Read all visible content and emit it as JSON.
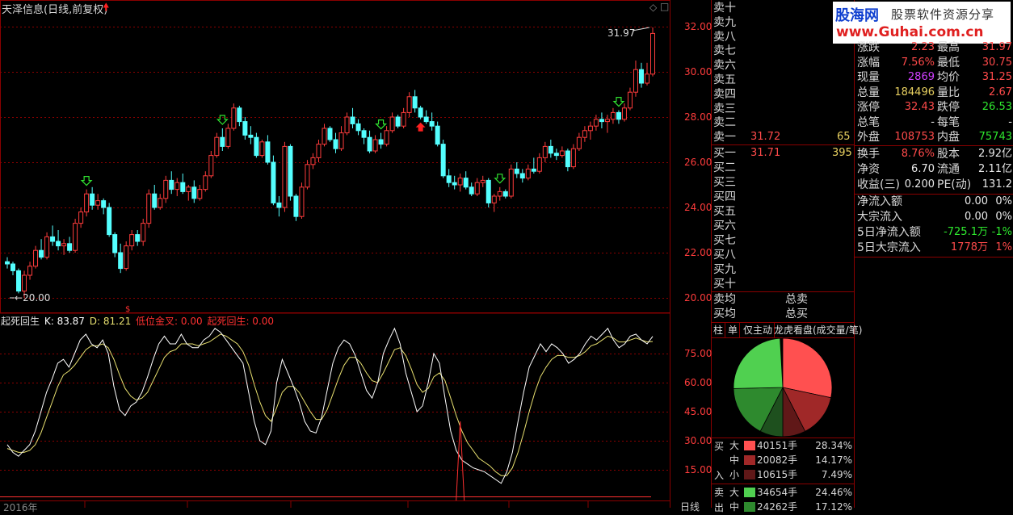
{
  "main_title": "天泽信息(日线,前复权)",
  "indicator": {
    "name": "起死回生",
    "k_text": "K: 83.87",
    "d_text": "D: 81.21",
    "g1_text": "低位金叉: 0.00",
    "g2_text": "起死回生: 0.00"
  },
  "price_axis": [
    "32.00",
    "30.00",
    "28.00",
    "26.00",
    "24.00",
    "22.00",
    "20.00"
  ],
  "ind_axis": [
    "75.00",
    "60.00",
    "45.00",
    "30.00",
    "15.00"
  ],
  "annot_high": "31.97",
  "annot_low": "20.00",
  "bottom_axis": {
    "date_label": "2016年",
    "period_label": "日线"
  },
  "logo": {
    "cn_text": "股海网",
    "slogan": "股票软件资源分享",
    "url": "www.Guhai.com.cn"
  },
  "sell_levels": [
    "卖十",
    "卖九",
    "卖八",
    "卖七",
    "卖六",
    "卖五",
    "卖四",
    "卖三",
    "卖二",
    "卖一"
  ],
  "sell1": {
    "price": "31.72",
    "vol": "65"
  },
  "buy_levels": [
    "买一",
    "买二",
    "买三",
    "买四",
    "买五",
    "买六",
    "买七",
    "买八",
    "买九",
    "买十"
  ],
  "buy1": {
    "price": "31.71",
    "vol": "395"
  },
  "avg_rows": [
    {
      "label": "卖均",
      "total": "总卖"
    },
    {
      "label": "买均",
      "total": "总买"
    }
  ],
  "stats_top": [
    {
      "l1": "涨跌",
      "v1": "2.23",
      "l2": "最高",
      "v2": "31.97"
    },
    {
      "l1": "涨幅",
      "v1": "7.56%",
      "l2": "最低",
      "v2": "30.75"
    },
    {
      "l1": "现量",
      "v1": "2869",
      "l2": "均价",
      "v2": "31.25"
    },
    {
      "l1": "总量",
      "v1": "184496",
      "l2": "量比",
      "v2": "2.67"
    },
    {
      "l1": "涨停",
      "v1": "32.43",
      "l2": "跌停",
      "v2": "26.53"
    },
    {
      "l1": "总笔",
      "v1": "-",
      "l2": "每笔",
      "v2": "-"
    },
    {
      "l1": "外盘",
      "v1": "108753",
      "l2": "内盘",
      "v2": "75743"
    }
  ],
  "stats_mid": [
    {
      "l1": "换手",
      "v1": "8.76%",
      "l2": "股本",
      "v2": "2.92亿"
    },
    {
      "l1": "净资",
      "v1": "6.70",
      "l2": "流通",
      "v2": "2.11亿"
    },
    {
      "l1": "收益(三)",
      "v1": "0.200",
      "l2": "PE(动)",
      "v2": "131.2"
    }
  ],
  "flow_rows": [
    {
      "label": "净流入额",
      "value": "0.00",
      "pct": "0%"
    },
    {
      "label": "大宗流入",
      "value": "0.00",
      "pct": "0%"
    },
    {
      "label": "5日净流入额",
      "value": "-725.1万",
      "pct": "-1%"
    },
    {
      "label": "5日大宗流入",
      "value": "1778万",
      "pct": "1%"
    }
  ],
  "tabs": [
    "柱",
    "单",
    "仅主动",
    "龙虎看盘(成交量/笔)"
  ],
  "pie": [
    {
      "share": 28.34,
      "color": "#ff5050"
    },
    {
      "share": 14.17,
      "color": "#a02828"
    },
    {
      "share": 7.49,
      "color": "#601818"
    },
    {
      "share": 7.53,
      "color": "#1e501e"
    },
    {
      "share": 17.12,
      "color": "#2e8a2e"
    },
    {
      "share": 24.46,
      "color": "#50d050"
    }
  ],
  "flow_side": {
    "buy_c1": "买",
    "buy_c2": "入",
    "sell_c1": "卖",
    "sell_c2": "出"
  },
  "flow_table": [
    {
      "side": "buy",
      "size": "大",
      "vol": "40151手",
      "pct": "28.34%",
      "color": "#ff5050"
    },
    {
      "side": "buy",
      "size": "中",
      "vol": "20082手",
      "pct": "14.17%",
      "color": "#a02828"
    },
    {
      "side": "buy",
      "size": "小",
      "vol": "10615手",
      "pct": "7.49%",
      "color": "#601818"
    },
    {
      "side": "sell",
      "size": "大",
      "vol": "34654手",
      "pct": "24.46%",
      "color": "#50d050"
    },
    {
      "side": "sell",
      "size": "中",
      "vol": "24262手",
      "pct": "17.12%",
      "color": "#2e8a2e"
    }
  ],
  "colors": {
    "up": "#ff3c3c",
    "down": "#54ffff",
    "grid": "#8a0000",
    "k_line": "#ffffff",
    "d_line": "#e8e070"
  },
  "chart_data": {
    "type": "candlestick",
    "price_range": [
      20,
      32
    ],
    "indicator_range": [
      0,
      100
    ],
    "kline": [
      [
        21.6,
        21.8,
        21.3,
        21.5
      ],
      [
        21.5,
        21.6,
        21.0,
        21.2
      ],
      [
        21.2,
        21.3,
        20.2,
        20.3
      ],
      [
        20.3,
        21.2,
        20.0,
        21.0
      ],
      [
        21.0,
        21.6,
        20.8,
        21.4
      ],
      [
        21.4,
        22.3,
        21.3,
        22.1
      ],
      [
        22.1,
        22.6,
        21.7,
        21.8
      ],
      [
        21.8,
        22.9,
        21.7,
        22.7
      ],
      [
        22.7,
        23.2,
        22.3,
        22.5
      ],
      [
        22.5,
        23.0,
        22.1,
        22.3
      ],
      [
        22.3,
        22.6,
        21.9,
        22.4
      ],
      [
        22.4,
        22.7,
        22.0,
        22.1
      ],
      [
        22.1,
        23.5,
        22.0,
        23.3
      ],
      [
        23.3,
        24.0,
        23.1,
        23.8
      ],
      [
        23.8,
        24.8,
        23.6,
        24.6
      ],
      [
        24.6,
        24.9,
        23.9,
        24.1
      ],
      [
        24.1,
        24.6,
        23.9,
        24.3
      ],
      [
        24.3,
        24.4,
        23.7,
        24.0
      ],
      [
        24.0,
        24.2,
        22.7,
        22.8
      ],
      [
        22.8,
        22.9,
        21.8,
        22.0
      ],
      [
        22.0,
        22.4,
        21.1,
        21.3
      ],
      [
        21.3,
        22.5,
        21.2,
        22.3
      ],
      [
        22.3,
        23.0,
        22.1,
        22.8
      ],
      [
        22.8,
        23.0,
        22.3,
        22.5
      ],
      [
        22.5,
        23.5,
        22.3,
        23.3
      ],
      [
        23.3,
        24.8,
        23.1,
        24.6
      ],
      [
        24.6,
        25.0,
        23.9,
        24.0
      ],
      [
        24.0,
        24.6,
        23.9,
        24.4
      ],
      [
        24.4,
        25.4,
        24.2,
        25.2
      ],
      [
        25.2,
        25.6,
        24.6,
        24.8
      ],
      [
        24.8,
        25.3,
        24.5,
        25.1
      ],
      [
        25.1,
        25.5,
        24.6,
        24.7
      ],
      [
        24.7,
        25.0,
        24.3,
        24.9
      ],
      [
        24.9,
        25.2,
        24.2,
        24.4
      ],
      [
        24.4,
        25.0,
        24.3,
        24.8
      ],
      [
        24.8,
        25.6,
        24.7,
        25.4
      ],
      [
        25.4,
        26.5,
        25.3,
        26.3
      ],
      [
        26.3,
        27.3,
        26.2,
        27.1
      ],
      [
        27.1,
        27.5,
        26.5,
        26.7
      ],
      [
        26.7,
        27.7,
        26.6,
        27.5
      ],
      [
        27.5,
        28.6,
        27.4,
        28.4
      ],
      [
        28.4,
        28.5,
        27.6,
        27.8
      ],
      [
        27.8,
        28.0,
        27.0,
        27.2
      ],
      [
        27.2,
        27.6,
        26.8,
        27.1
      ],
      [
        27.1,
        27.3,
        26.2,
        26.3
      ],
      [
        26.3,
        27.0,
        26.2,
        26.9
      ],
      [
        26.9,
        27.2,
        25.9,
        26.0
      ],
      [
        26.0,
        26.3,
        24.1,
        24.2
      ],
      [
        24.2,
        24.5,
        23.6,
        24.0
      ],
      [
        24.0,
        26.9,
        23.8,
        26.7
      ],
      [
        26.7,
        26.8,
        24.3,
        24.5
      ],
      [
        24.5,
        24.6,
        23.4,
        23.6
      ],
      [
        23.6,
        25.1,
        23.5,
        24.9
      ],
      [
        24.9,
        26.1,
        24.8,
        25.9
      ],
      [
        25.9,
        26.4,
        25.7,
        26.2
      ],
      [
        26.2,
        27.0,
        26.0,
        26.8
      ],
      [
        26.8,
        27.7,
        26.7,
        27.5
      ],
      [
        27.5,
        27.6,
        26.9,
        27.0
      ],
      [
        27.0,
        27.3,
        26.4,
        26.6
      ],
      [
        26.6,
        27.6,
        26.5,
        27.3
      ],
      [
        27.3,
        28.2,
        27.2,
        28.0
      ],
      [
        28.0,
        28.4,
        27.5,
        27.7
      ],
      [
        27.7,
        27.9,
        27.2,
        27.4
      ],
      [
        27.4,
        27.5,
        26.8,
        27.1
      ],
      [
        27.1,
        27.4,
        26.4,
        26.5
      ],
      [
        26.5,
        27.2,
        26.4,
        27.0
      ],
      [
        27.0,
        27.3,
        26.6,
        26.8
      ],
      [
        26.8,
        27.6,
        26.7,
        27.4
      ],
      [
        27.4,
        28.2,
        27.3,
        28.0
      ],
      [
        28.0,
        28.1,
        27.5,
        27.6
      ],
      [
        27.6,
        28.4,
        27.5,
        28.2
      ],
      [
        28.2,
        29.1,
        28.0,
        28.9
      ],
      [
        28.9,
        29.2,
        28.2,
        28.4
      ],
      [
        28.4,
        28.5,
        27.9,
        28.0
      ],
      [
        28.0,
        28.3,
        27.7,
        27.8
      ],
      [
        27.8,
        28.2,
        27.4,
        27.6
      ],
      [
        27.6,
        27.8,
        26.7,
        26.8
      ],
      [
        26.8,
        27.0,
        25.3,
        25.4
      ],
      [
        25.4,
        25.7,
        24.9,
        25.1
      ],
      [
        25.1,
        25.4,
        24.8,
        25.0
      ],
      [
        25.0,
        25.5,
        24.7,
        25.3
      ],
      [
        25.3,
        25.6,
        24.8,
        24.9
      ],
      [
        24.9,
        25.1,
        24.5,
        24.6
      ],
      [
        24.6,
        25.3,
        24.5,
        25.1
      ],
      [
        25.1,
        25.4,
        24.9,
        25.2
      ],
      [
        25.2,
        25.3,
        24.0,
        24.2
      ],
      [
        24.2,
        24.6,
        23.8,
        24.5
      ],
      [
        24.5,
        24.9,
        24.3,
        24.7
      ],
      [
        24.7,
        24.8,
        24.4,
        24.5
      ],
      [
        24.5,
        25.9,
        24.4,
        25.7
      ],
      [
        25.7,
        26.0,
        25.3,
        25.5
      ],
      [
        25.5,
        25.7,
        25.1,
        25.3
      ],
      [
        25.3,
        25.9,
        25.2,
        25.7
      ],
      [
        25.7,
        26.2,
        25.5,
        25.6
      ],
      [
        25.6,
        26.4,
        25.5,
        26.2
      ],
      [
        26.2,
        26.9,
        26.0,
        26.7
      ],
      [
        26.7,
        27.0,
        26.2,
        26.4
      ],
      [
        26.4,
        26.6,
        26.1,
        26.3
      ],
      [
        26.3,
        26.7,
        26.2,
        26.5
      ],
      [
        26.5,
        26.6,
        25.6,
        25.8
      ],
      [
        25.8,
        26.8,
        25.7,
        26.6
      ],
      [
        26.6,
        27.3,
        26.5,
        27.1
      ],
      [
        27.1,
        27.6,
        26.9,
        27.4
      ],
      [
        27.4,
        27.8,
        27.0,
        27.6
      ],
      [
        27.6,
        28.1,
        27.4,
        27.9
      ],
      [
        27.9,
        28.2,
        27.5,
        27.8
      ],
      [
        27.8,
        28.1,
        27.3,
        27.9
      ],
      [
        27.9,
        28.4,
        27.7,
        28.2
      ],
      [
        28.2,
        28.3,
        27.7,
        27.9
      ],
      [
        27.9,
        28.6,
        27.8,
        28.4
      ],
      [
        28.4,
        29.3,
        28.3,
        29.1
      ],
      [
        29.1,
        30.5,
        28.9,
        30.1
      ],
      [
        30.1,
        30.4,
        29.3,
        29.5
      ],
      [
        29.5,
        30.4,
        29.4,
        29.9
      ],
      [
        29.9,
        31.97,
        29.8,
        31.7
      ]
    ],
    "k_series": [
      28,
      24,
      22,
      25,
      28,
      35,
      45,
      55,
      62,
      70,
      72,
      68,
      75,
      82,
      85,
      80,
      78,
      82,
      75,
      58,
      46,
      43,
      48,
      50,
      55,
      63,
      72,
      80,
      84,
      80,
      80,
      85,
      80,
      78,
      78,
      82,
      84,
      88,
      86,
      82,
      78,
      74,
      70,
      55,
      40,
      30,
      28,
      35,
      60,
      72,
      65,
      58,
      50,
      40,
      35,
      34,
      42,
      56,
      70,
      78,
      82,
      80,
      74,
      65,
      56,
      52,
      60,
      75,
      82,
      88,
      80,
      65,
      55,
      45,
      48,
      60,
      75,
      70,
      52,
      35,
      25,
      20,
      18,
      16,
      15,
      14,
      12,
      10,
      8,
      14,
      24,
      40,
      55,
      68,
      74,
      80,
      76,
      80,
      78,
      75,
      70,
      72,
      75,
      80,
      84,
      82,
      85,
      88,
      82,
      78,
      80,
      84,
      85,
      82,
      80,
      83.87
    ],
    "d_series": [
      26,
      25,
      24,
      24,
      25,
      28,
      34,
      42,
      50,
      58,
      64,
      66,
      69,
      73,
      77,
      79,
      79,
      80,
      78,
      72,
      64,
      57,
      53,
      51,
      52,
      55,
      61,
      67,
      73,
      76,
      77,
      80,
      80,
      80,
      79,
      80,
      81,
      83,
      85,
      84,
      82,
      80,
      76,
      69,
      59,
      50,
      43,
      40,
      47,
      55,
      58,
      58,
      55,
      50,
      45,
      41,
      41,
      46,
      54,
      62,
      69,
      73,
      73,
      70,
      65,
      61,
      60,
      65,
      71,
      77,
      78,
      74,
      67,
      59,
      55,
      57,
      63,
      65,
      61,
      52,
      43,
      35,
      29,
      25,
      21,
      19,
      17,
      14,
      12,
      12,
      16,
      24,
      34,
      45,
      55,
      63,
      68,
      72,
      74,
      74,
      73,
      73,
      74,
      76,
      79,
      80,
      82,
      84,
      83,
      81,
      81,
      82,
      83,
      82,
      81,
      81.21
    ],
    "signals": {
      "green_arrows_at": [
        14,
        38,
        66,
        87,
        108
      ],
      "red_arrow_at": 73,
      "ind_spike_at": 80
    }
  }
}
